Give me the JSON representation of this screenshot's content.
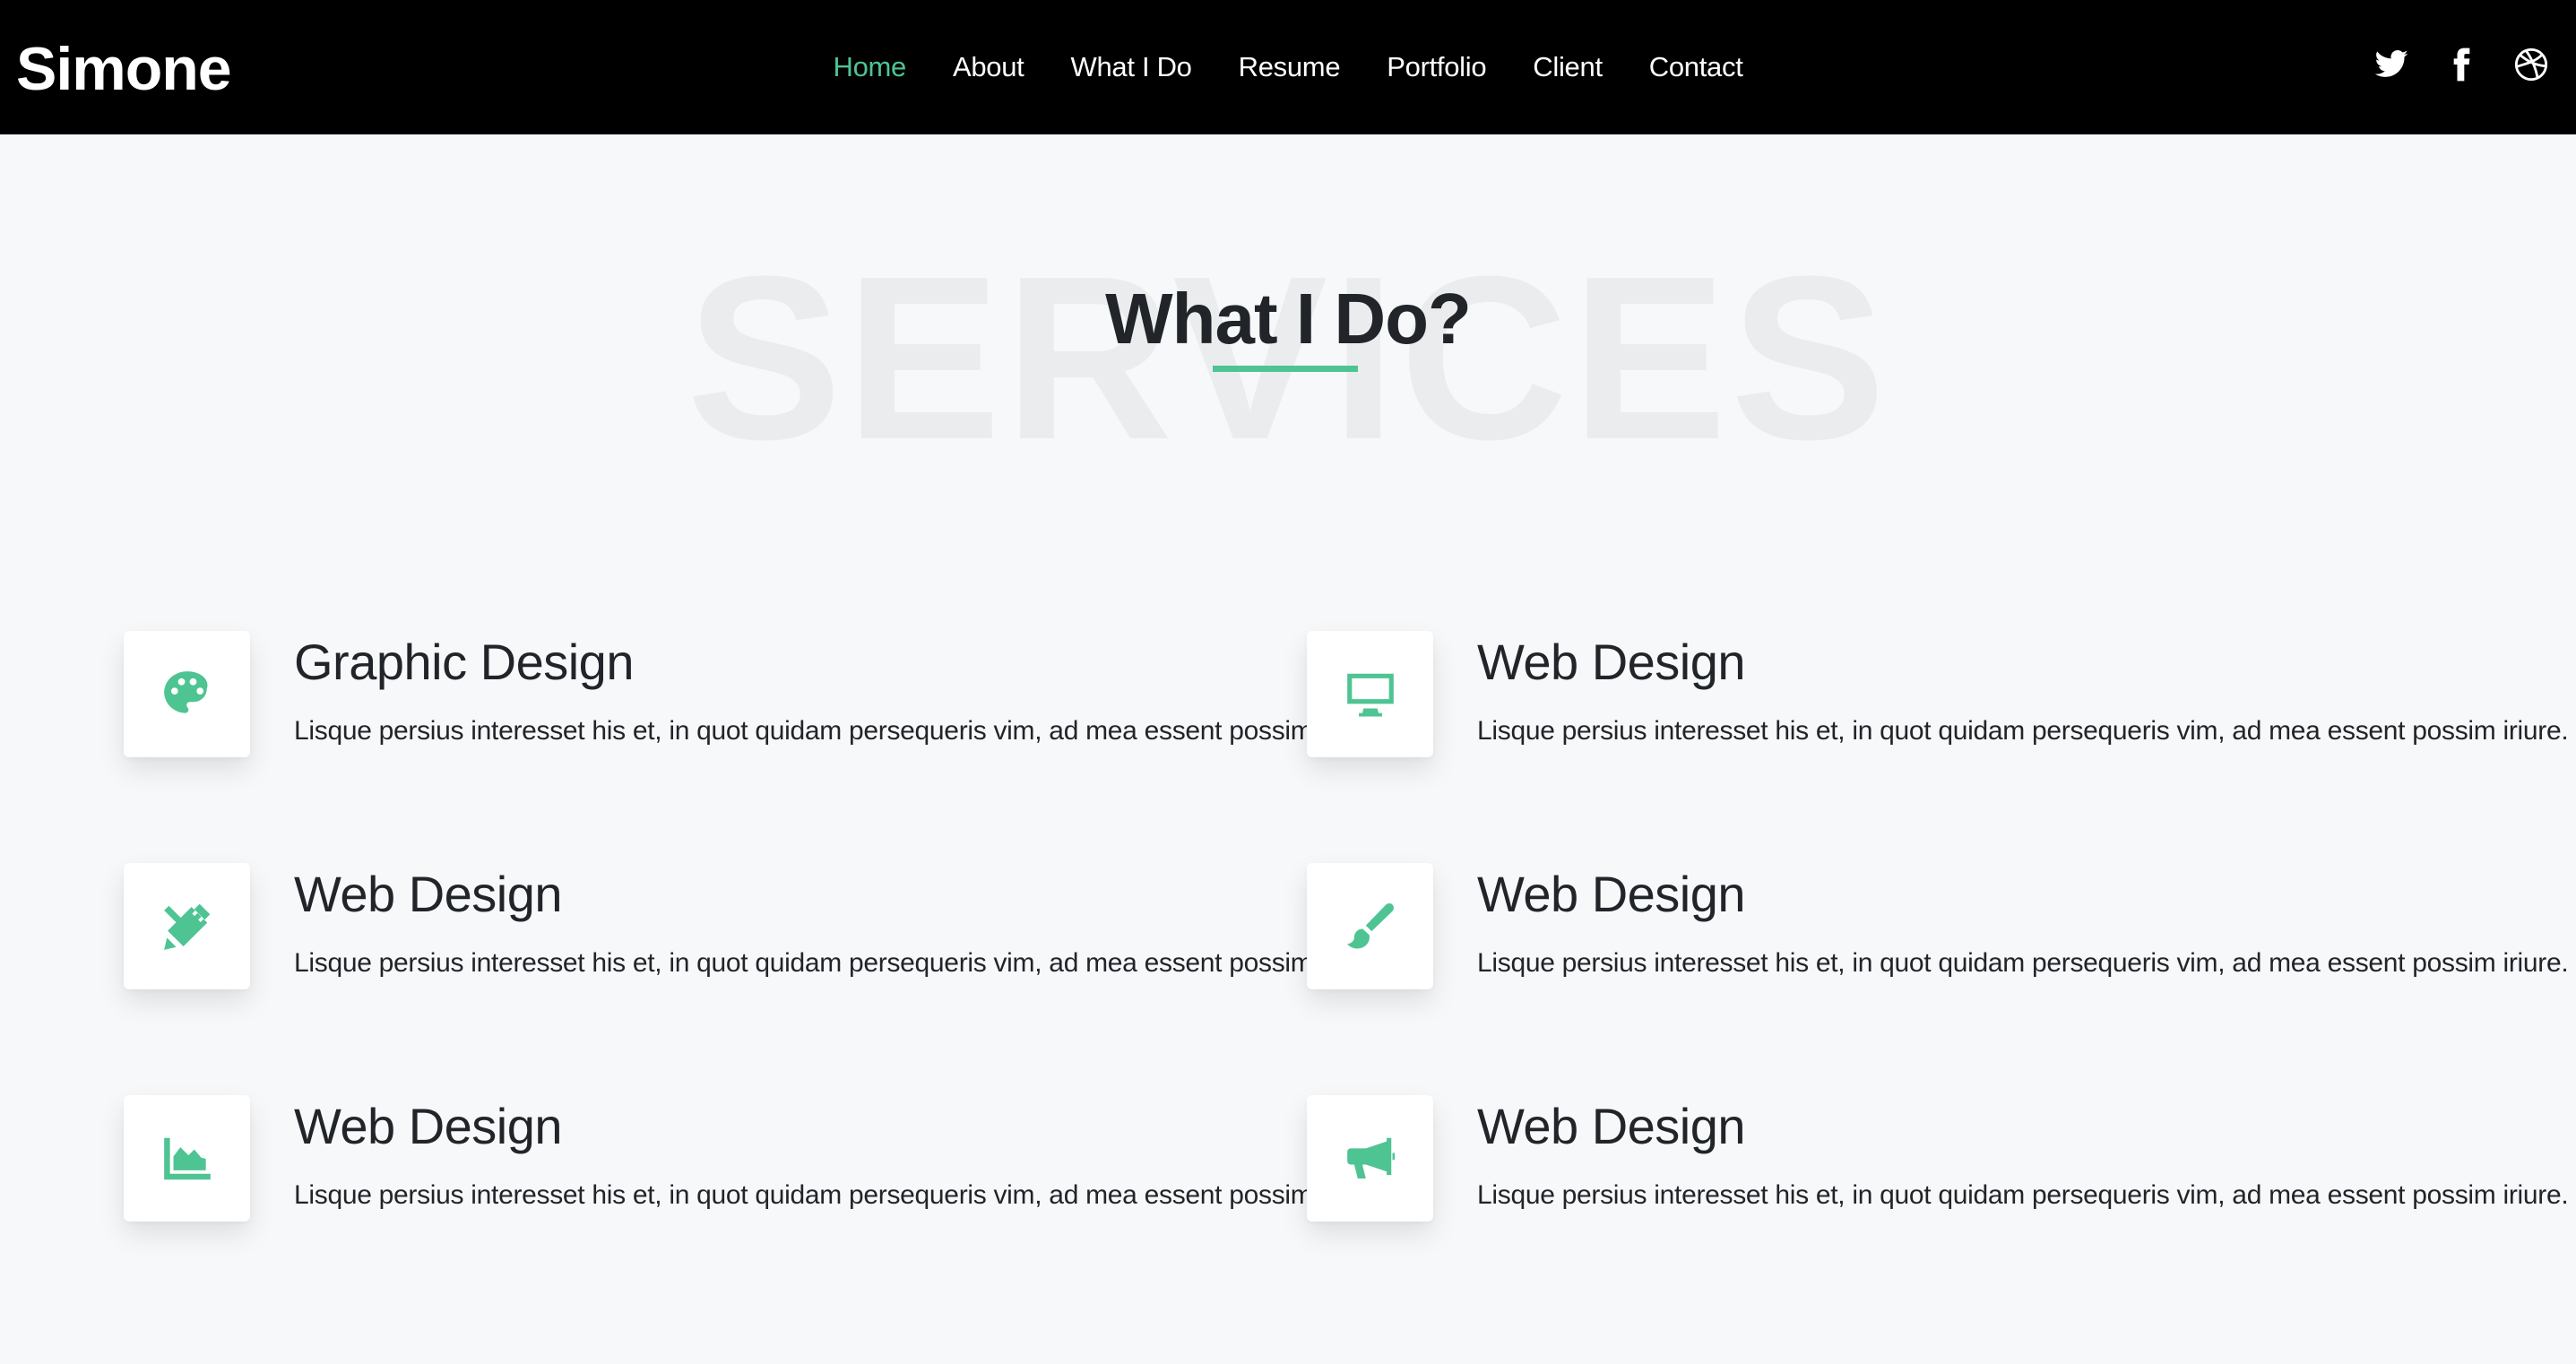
{
  "brand": "Simone",
  "nav": {
    "items": [
      "Home",
      "About",
      "What I Do",
      "Resume",
      "Portfolio",
      "Client",
      "Contact"
    ],
    "active": "Home"
  },
  "social": [
    "twitter-icon",
    "facebook-icon",
    "dribbble-icon"
  ],
  "section": {
    "watermark": "SERVICES",
    "title": "What I Do?"
  },
  "accent_color": "#4ec493",
  "services": [
    {
      "icon": "palette-icon",
      "title": "Graphic Design",
      "text": "Lisque persius interesset his et, in quot quidam persequeris vim, ad mea essent possim iriure."
    },
    {
      "icon": "desktop-icon",
      "title": "Web Design",
      "text": "Lisque persius interesset his et, in quot quidam persequeris vim, ad mea essent possim iriure."
    },
    {
      "icon": "pencil-ruler-icon",
      "title": "Web Design",
      "text": "Lisque persius interesset his et, in quot quidam persequeris vim, ad mea essent possim iriure."
    },
    {
      "icon": "paint-brush-icon",
      "title": "Web Design",
      "text": "Lisque persius interesset his et, in quot quidam persequeris vim, ad mea essent possim iriure."
    },
    {
      "icon": "area-chart-icon",
      "title": "Web Design",
      "text": "Lisque persius interesset his et, in quot quidam persequeris vim, ad mea essent possim iriure."
    },
    {
      "icon": "bullhorn-icon",
      "title": "Web Design",
      "text": "Lisque persius interesset his et, in quot quidam persequeris vim, ad mea essent possim iriure."
    }
  ]
}
